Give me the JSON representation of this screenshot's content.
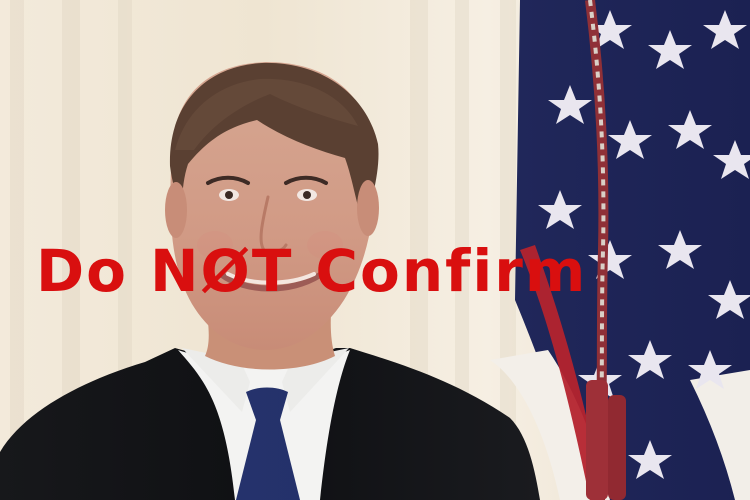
{
  "overlay_text": {
    "word_1": "Do",
    "word_2": "NØT",
    "word_3": "Confirm",
    "color": "#d90f0f"
  },
  "scene": {
    "description_elements": [
      "curtain",
      "flag",
      "person"
    ],
    "colors": {
      "curtain": "#efe7d6",
      "flag_blue": "#1f2a62",
      "flag_red": "#b4232e",
      "suit": "#151619",
      "shirt": "#f2f2f2",
      "tie": "#25336e",
      "skin": "#d7a58a",
      "hair": "#5a4032"
    }
  }
}
